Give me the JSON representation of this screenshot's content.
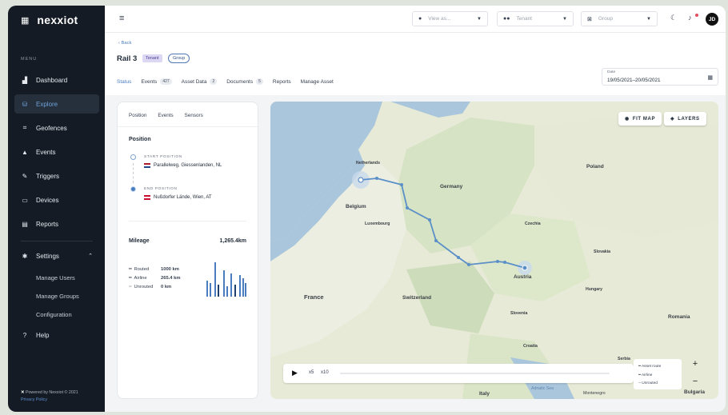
{
  "sidebar": {
    "brand": "nexxiot",
    "menu_label": "MENU",
    "items": [
      {
        "label": "Dashboard",
        "icon": "dashboard-icon"
      },
      {
        "label": "Explore",
        "icon": "binoculars-icon"
      },
      {
        "label": "Geofences",
        "icon": "geofence-icon"
      },
      {
        "label": "Events",
        "icon": "warning-icon"
      },
      {
        "label": "Triggers",
        "icon": "trigger-icon"
      },
      {
        "label": "Devices",
        "icon": "device-icon"
      },
      {
        "label": "Reports",
        "icon": "report-icon"
      }
    ],
    "settings": {
      "label": "Settings",
      "sub_items": [
        "Manage Users",
        "Manage Groups",
        "Configuration"
      ]
    },
    "help": "Help",
    "footer": {
      "powered_by": "Powered by Nexxiot © 2021",
      "privacy": "Privacy Policy"
    }
  },
  "topbar": {
    "view_as_placeholder": "View as...",
    "tenant_placeholder": "Tenant",
    "group_placeholder": "Group",
    "avatar_initials": "JD"
  },
  "header": {
    "back": "Back",
    "title": "Rail 3",
    "badge_tenant": "Tenant",
    "badge_group": "Group",
    "tabs": [
      {
        "label": "Status",
        "count": ""
      },
      {
        "label": "Events",
        "count": "427"
      },
      {
        "label": "Asset Data",
        "count": "2"
      },
      {
        "label": "Documents",
        "count": "5"
      },
      {
        "label": "Reports",
        "count": ""
      },
      {
        "label": "Manage Asset",
        "count": ""
      }
    ],
    "date_label": "Date",
    "date_value": "19/05/2021–20/05/2021"
  },
  "panel": {
    "tabs": [
      "Position",
      "Events",
      "Sensors"
    ],
    "position_heading": "Position",
    "start_label": "START POSITION",
    "start_value": "Parallelweg, Giessenlanden, NL",
    "end_label": "END POSITION",
    "end_value": "Nußdorfer Lände, Wien, AT",
    "mileage_label": "Mileage",
    "mileage_value": "1,265.4km",
    "routed_label": "Routed",
    "routed_value": "1000 km",
    "airline_label": "Airline",
    "airline_value": "265.4 km",
    "unrouted_label": "Unrouted",
    "unrouted_value": "0 km"
  },
  "map": {
    "fit_map": "FIT MAP",
    "layers": "LAYERS",
    "speed_x5": "x5",
    "speed_x10": "x10",
    "legend": [
      "Asset route",
      "Airline",
      "Unrouted"
    ],
    "zoom_in": "+",
    "zoom_out": "−",
    "labels": {
      "netherlands": "Netherlands",
      "germany": "Germany",
      "poland": "Poland",
      "belgium": "Belgium",
      "luxembourg": "Luxembourg",
      "czechia": "Czechia",
      "slovakia": "Slovakia",
      "france": "France",
      "switzerland": "Switzerland",
      "austria": "Austria",
      "hungary": "Hungary",
      "slovenia": "Slovenia",
      "croatia": "Croatia",
      "romania": "Romania",
      "serbia": "Serbia",
      "italy": "Italy",
      "adriatic": "Adriatic Sea",
      "montenegro": "Montenegro",
      "bulgaria": "Bulgaria"
    }
  },
  "colors": {
    "sidebar_bg": "#141b24",
    "accent": "#4a7cc0",
    "route": "#5a8fc8"
  }
}
